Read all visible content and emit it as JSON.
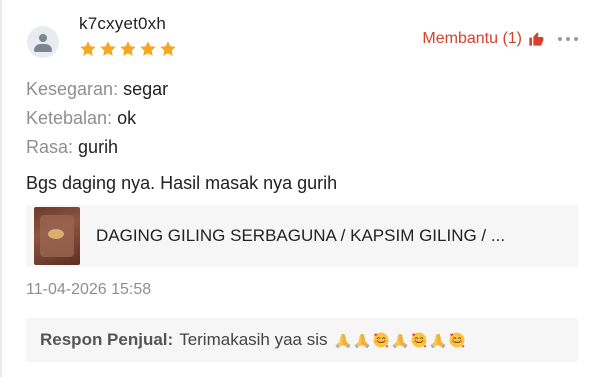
{
  "review": {
    "username": "k7cxyet0xh",
    "rating": 5,
    "helpful_label": "Membantu (1)",
    "attributes": [
      {
        "key": "Kesegaran:",
        "value": "segar"
      },
      {
        "key": "Ketebalan:",
        "value": "ok"
      },
      {
        "key": "Rasa:",
        "value": "gurih"
      }
    ],
    "text": "Bgs daging nya. Hasil masak nya gurih",
    "product_name": "DAGING GILING SERBAGUNA / KAPSIM GILING / ...",
    "timestamp": "11-04-2026 15:58"
  },
  "seller_response": {
    "label": "Respon Penjual:",
    "message": "Terimakasih yaa sis",
    "emojis": [
      "folded-hands",
      "folded-hands",
      "smiling-face-with-hearts",
      "folded-hands",
      "smiling-face-with-hearts",
      "folded-hands",
      "smiling-face-with-hearts"
    ]
  },
  "colors": {
    "accent": "#d8402c",
    "star": "#f5a623",
    "muted": "#8f8f8f",
    "card_bg": "#f6f6f6"
  }
}
